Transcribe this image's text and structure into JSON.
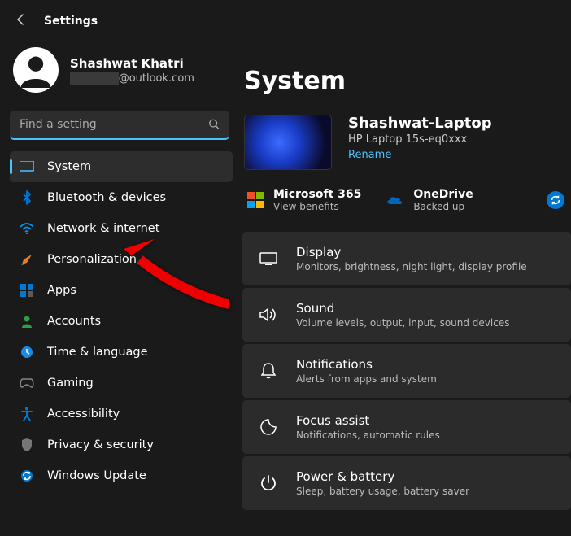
{
  "header": {
    "title": "Settings"
  },
  "profile": {
    "name": "Shashwat Khatri",
    "email_suffix": "@outlook.com"
  },
  "search": {
    "placeholder": "Find a setting"
  },
  "nav": [
    {
      "label": "System",
      "icon": "system"
    },
    {
      "label": "Bluetooth & devices",
      "icon": "bluetooth"
    },
    {
      "label": "Network & internet",
      "icon": "network"
    },
    {
      "label": "Personalization",
      "icon": "personalization"
    },
    {
      "label": "Apps",
      "icon": "apps"
    },
    {
      "label": "Accounts",
      "icon": "accounts"
    },
    {
      "label": "Time & language",
      "icon": "time"
    },
    {
      "label": "Gaming",
      "icon": "gaming"
    },
    {
      "label": "Accessibility",
      "icon": "accessibility"
    },
    {
      "label": "Privacy & security",
      "icon": "privacy"
    },
    {
      "label": "Windows Update",
      "icon": "update"
    }
  ],
  "page": {
    "title": "System"
  },
  "device": {
    "name": "Shashwat-Laptop",
    "model": "HP Laptop 15s-eq0xxx",
    "rename": "Rename"
  },
  "services": {
    "ms365": {
      "title": "Microsoft 365",
      "sub": "View benefits"
    },
    "onedrive": {
      "title": "OneDrive",
      "sub": "Backed up"
    }
  },
  "settings": [
    {
      "title": "Display",
      "sub": "Monitors, brightness, night light, display profile",
      "icon": "display"
    },
    {
      "title": "Sound",
      "sub": "Volume levels, output, input, sound devices",
      "icon": "sound"
    },
    {
      "title": "Notifications",
      "sub": "Alerts from apps and system",
      "icon": "notifications"
    },
    {
      "title": "Focus assist",
      "sub": "Notifications, automatic rules",
      "icon": "focus"
    },
    {
      "title": "Power & battery",
      "sub": "Sleep, battery usage, battery saver",
      "icon": "power"
    }
  ]
}
